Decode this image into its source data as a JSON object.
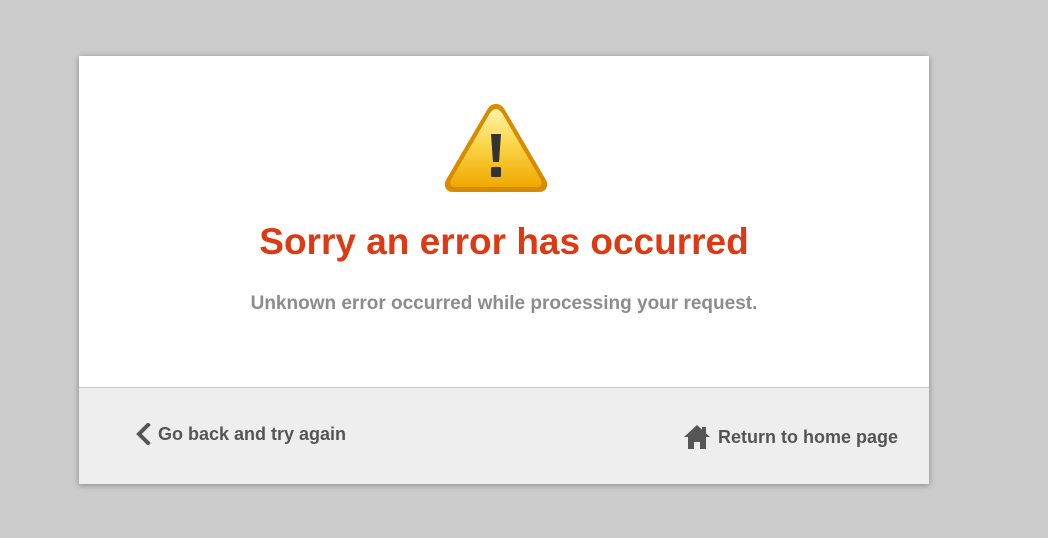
{
  "dialog": {
    "title": "Sorry an error has occurred",
    "message": "Unknown error occurred while processing your request.",
    "icon": "warning-icon",
    "title_color": "#dd3a14"
  },
  "footer": {
    "back_label": "Go back and try again",
    "back_icon": "chevron-left-icon",
    "home_label": "Return to home page",
    "home_icon": "home-icon"
  }
}
